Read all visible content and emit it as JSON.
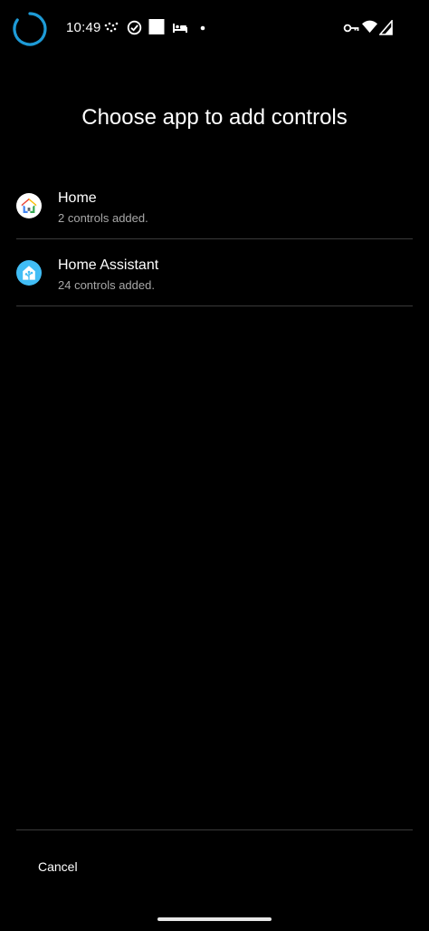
{
  "status_bar": {
    "time": "10:49",
    "icons_left": [
      "loading-spinner-icon",
      "sync-dots-icon",
      "check-circle-icon",
      "square-icon",
      "bed-icon",
      "dot-icon"
    ],
    "icons_right": [
      "vpn-key-icon",
      "wifi-icon",
      "cellular-signal-icon"
    ]
  },
  "title": "Choose app to add controls",
  "apps": [
    {
      "name": "Home",
      "subtitle": "2 controls added.",
      "icon": "google-home-icon"
    },
    {
      "name": "Home Assistant",
      "subtitle": "24 controls added.",
      "icon": "home-assistant-icon"
    }
  ],
  "footer": {
    "cancel_label": "Cancel"
  },
  "colors": {
    "background": "#000000",
    "divider": "#3a3a3a",
    "secondary_text": "#a8a8a8",
    "spinner": "#1e9bd7",
    "home_assistant": "#41bdf5"
  }
}
